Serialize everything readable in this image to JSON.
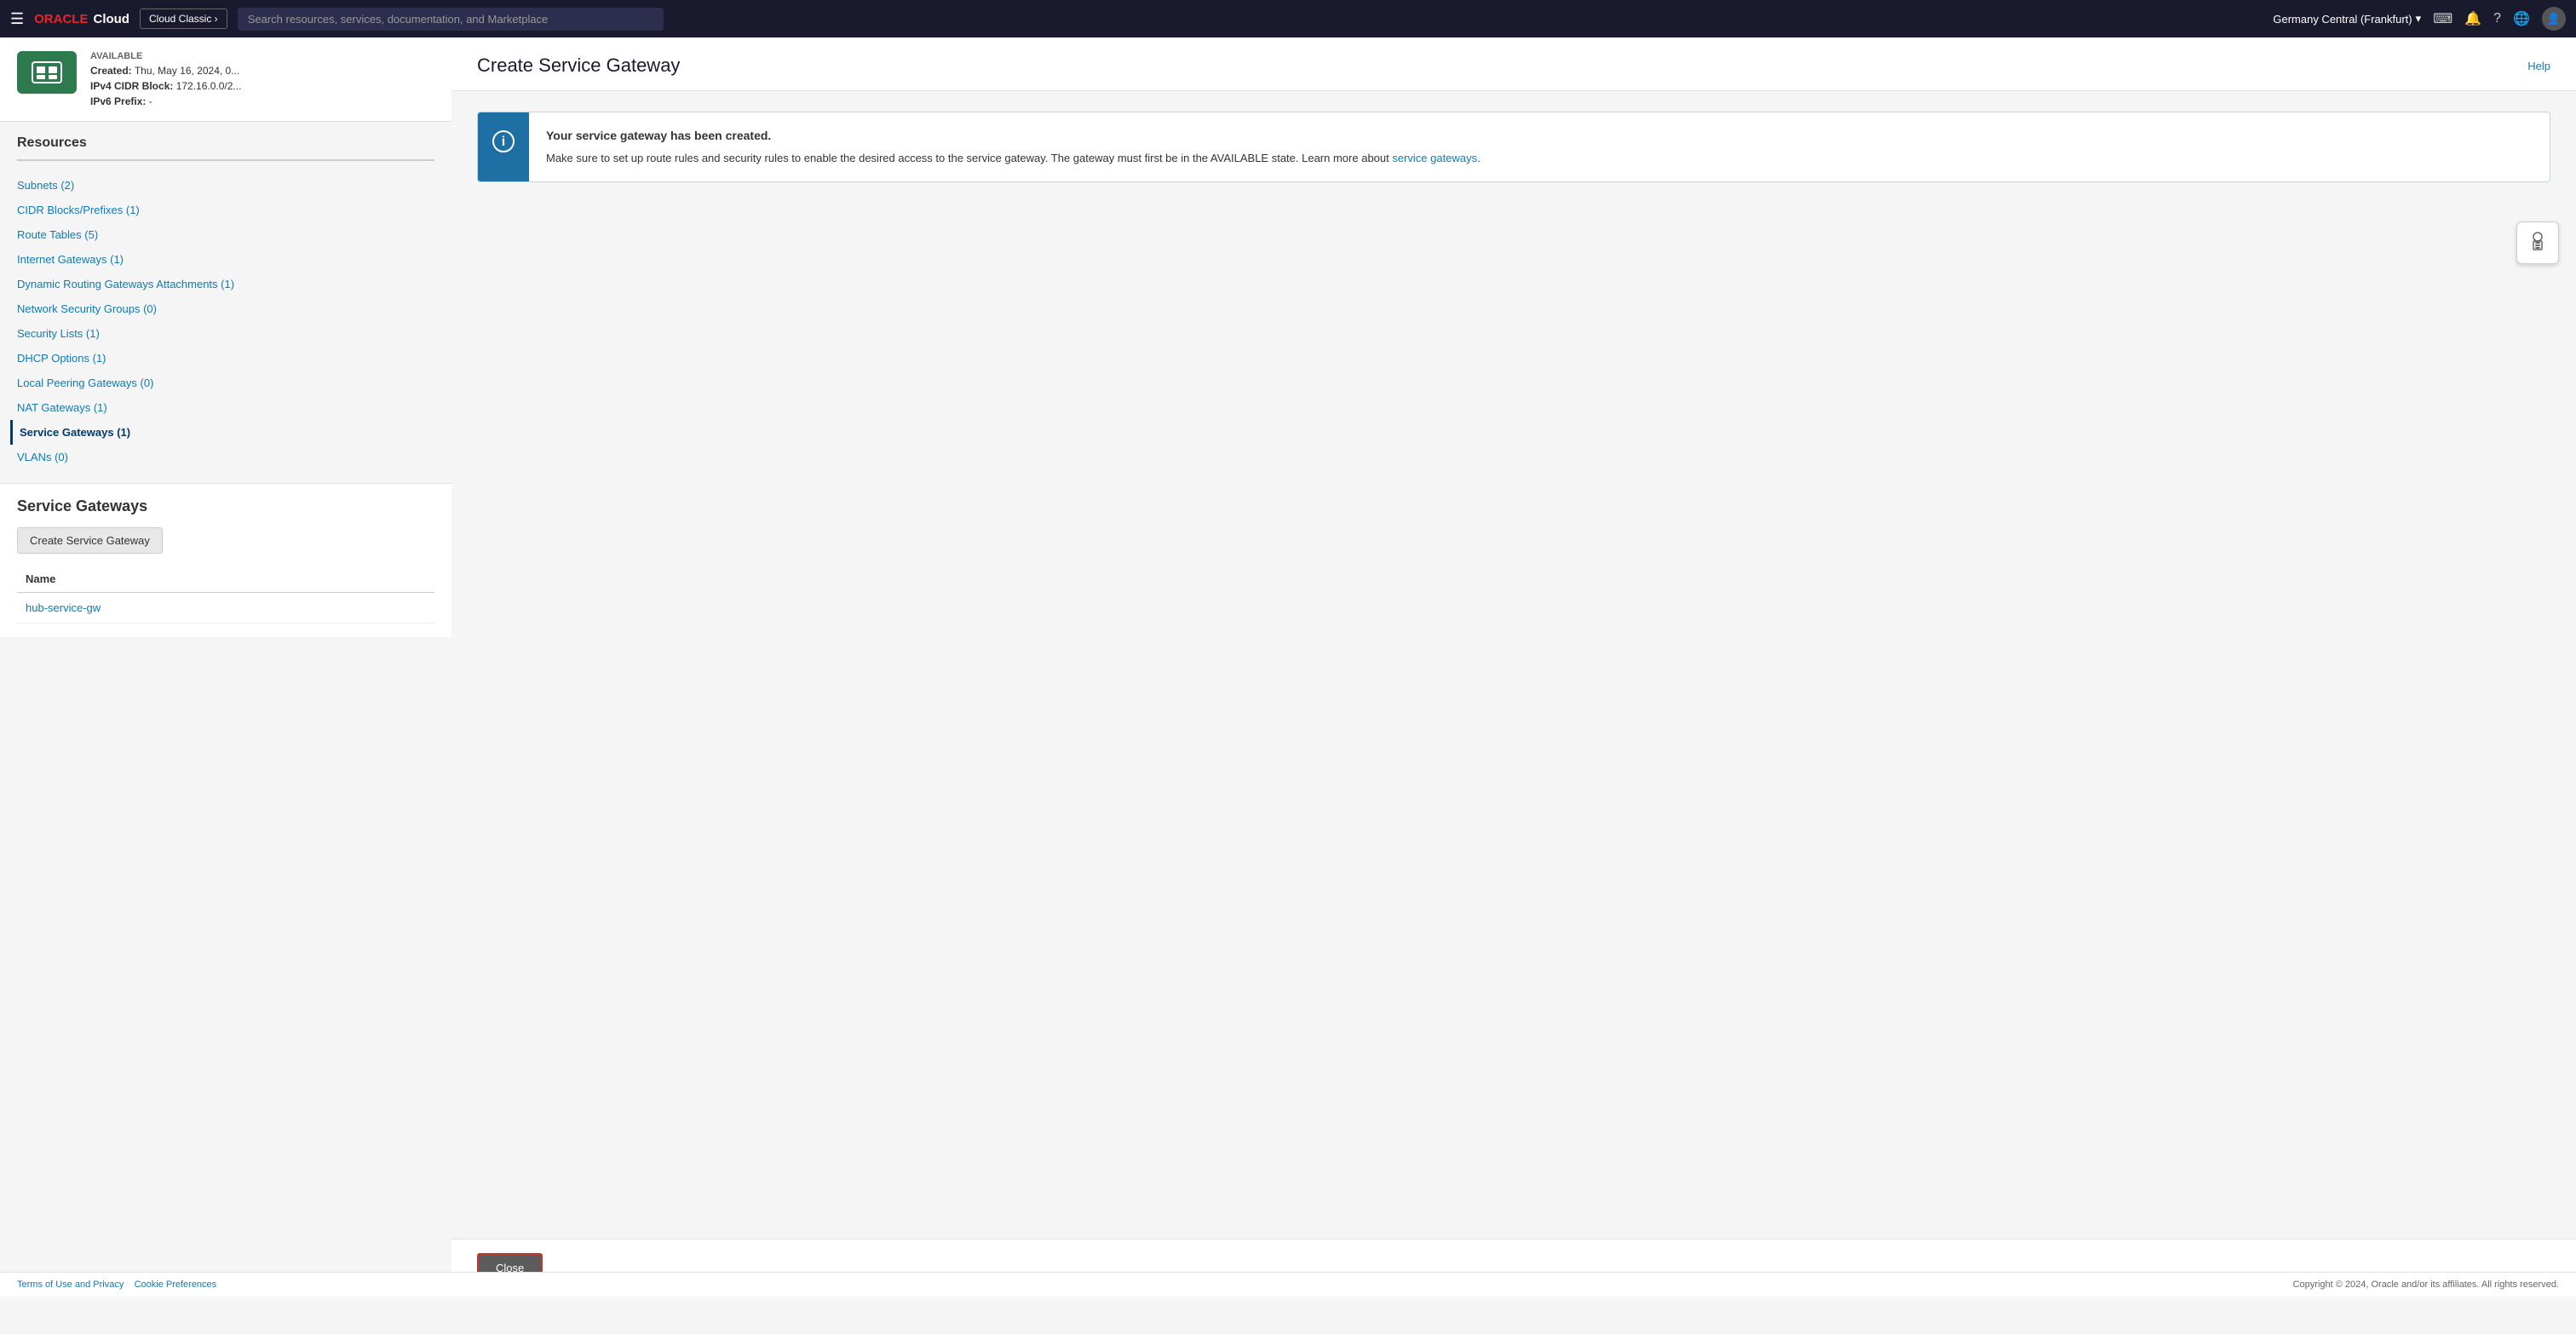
{
  "topbar": {
    "hamburger_label": "☰",
    "logo_oracle": "ORACLE",
    "logo_cloud": "Cloud",
    "cloud_classic_label": "Cloud Classic ›",
    "search_placeholder": "Search resources, services, documentation, and Marketplace",
    "region_label": "Germany Central (Frankfurt)",
    "region_icon": "▾",
    "icons": {
      "code": "⌨",
      "bell": "🔔",
      "help": "?",
      "globe": "🌐",
      "user": "👤"
    }
  },
  "vcn": {
    "badge_text": "",
    "status_label": "AVAILABLE",
    "created_label": "Created:",
    "created_value": "Thu, May 16, 2024, 0...",
    "ipv4_label": "IPv4 CIDR Block:",
    "ipv4_value": "172.16.0.0/2...",
    "ipv6_label": "IPv6 Prefix:",
    "ipv6_value": "-"
  },
  "resources": {
    "title": "Resources",
    "items": [
      {
        "label": "Subnets (2)",
        "active": false
      },
      {
        "label": "CIDR Blocks/Prefixes (1)",
        "active": false
      },
      {
        "label": "Route Tables (5)",
        "active": false
      },
      {
        "label": "Internet Gateways (1)",
        "active": false
      },
      {
        "label": "Dynamic Routing Gateways Attachments (1)",
        "active": false
      },
      {
        "label": "Network Security Groups (0)",
        "active": false
      },
      {
        "label": "Security Lists (1)",
        "active": false
      },
      {
        "label": "DHCP Options (1)",
        "active": false
      },
      {
        "label": "Local Peering Gateways (0)",
        "active": false
      },
      {
        "label": "NAT Gateways (1)",
        "active": false
      },
      {
        "label": "Service Gateways (1)",
        "active": true
      },
      {
        "label": "VLANs (0)",
        "active": false
      }
    ]
  },
  "service_gateways": {
    "title": "Service Gateways",
    "create_button_label": "Create Service Gateway",
    "table_header_name": "Name",
    "table_rows": [
      {
        "name": "hub-service-gw"
      }
    ]
  },
  "dialog": {
    "title": "Create Service Gateway",
    "help_label": "Help",
    "banner": {
      "headline": "Your service gateway has been created.",
      "body_prefix": "Make sure to set up route rules and security rules to enable the desired access to the service gateway. The gateway must first be in the AVAILABLE state. Learn more about ",
      "link_text": "service gateways",
      "body_suffix": "."
    },
    "close_button_label": "Close"
  },
  "footer": {
    "terms_label": "Terms of Use and Privacy",
    "cookie_label": "Cookie Preferences",
    "copyright": "Copyright © 2024, Oracle and/or its affiliates. All rights reserved."
  }
}
